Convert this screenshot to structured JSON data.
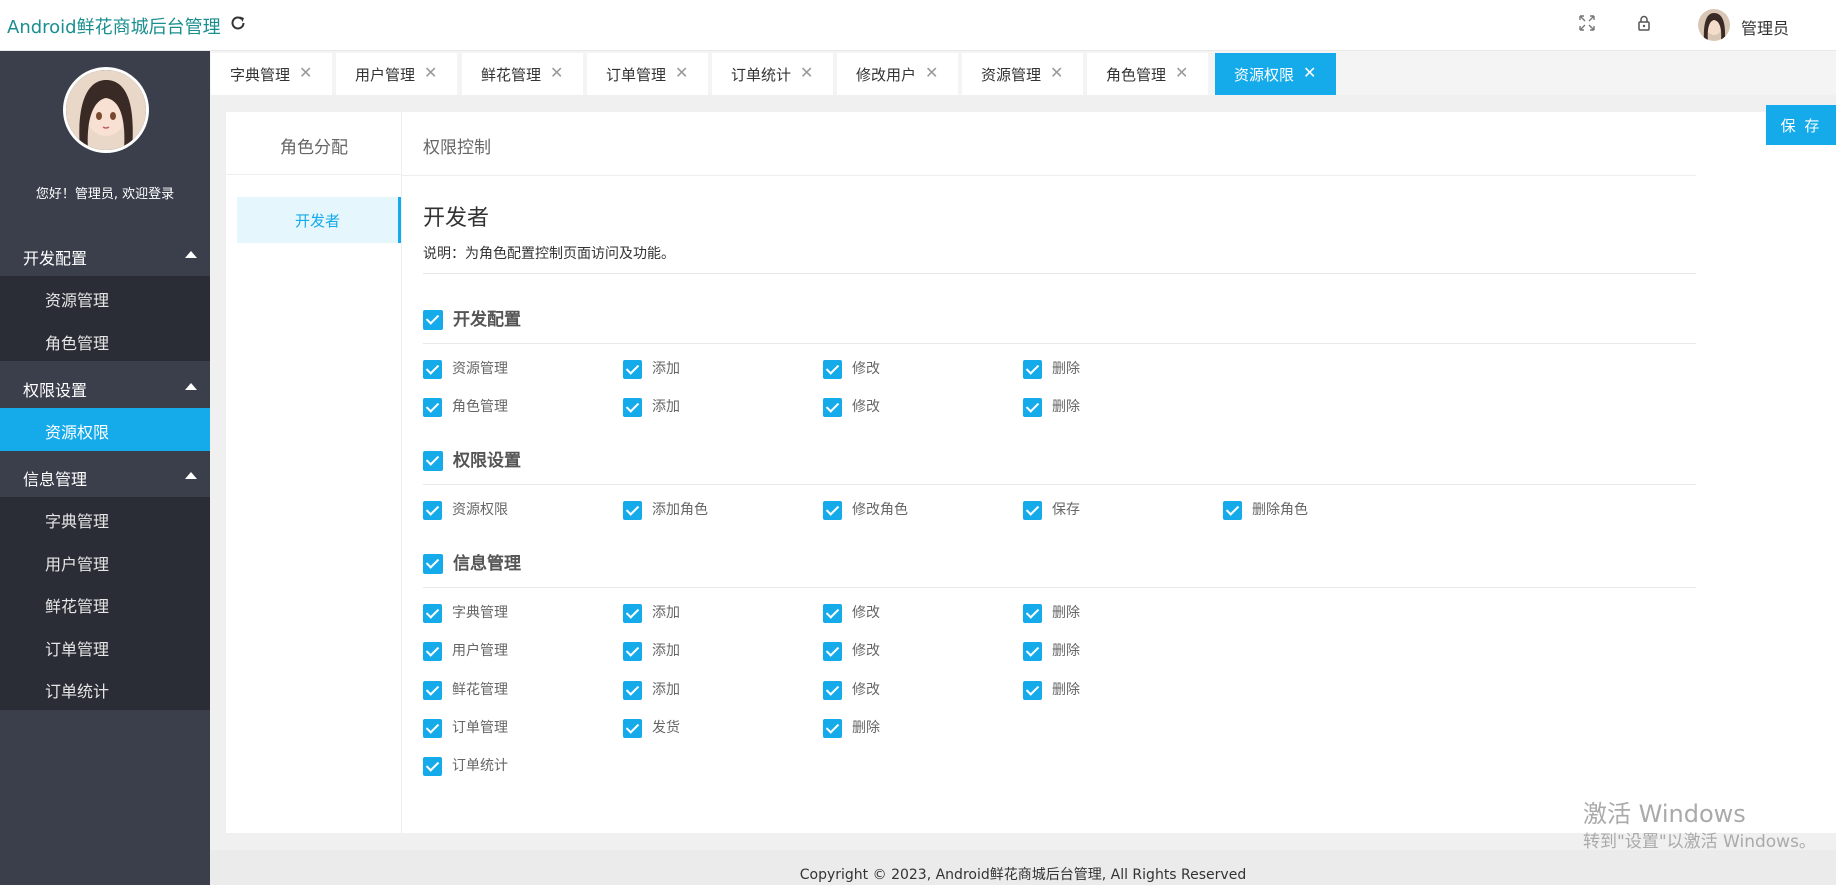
{
  "header": {
    "app_title": "Android鲜花商城后台管理",
    "user_name": "管理员"
  },
  "sidebar": {
    "welcome": "您好！管理员, 欢迎登录",
    "groups": [
      {
        "label": "开发配置",
        "items": [
          "资源管理",
          "角色管理"
        ]
      },
      {
        "label": "权限设置",
        "items": [
          "资源权限"
        ]
      },
      {
        "label": "信息管理",
        "items": [
          "字典管理",
          "用户管理",
          "鲜花管理",
          "订单管理",
          "订单统计"
        ]
      }
    ],
    "active_item": "资源权限"
  },
  "tabs": [
    "字典管理",
    "用户管理",
    "鲜花管理",
    "订单管理",
    "订单统计",
    "修改用户",
    "资源管理",
    "角色管理",
    "资源权限"
  ],
  "active_tab": "资源权限",
  "main": {
    "left_header": "角色分配",
    "right_header": "权限控制",
    "save_label": "保 存",
    "roles": [
      "开发者"
    ],
    "role_title": "开发者",
    "description": "说明：为角色配置控制页面访问及功能。",
    "groups": [
      {
        "label": "开发配置",
        "checked": true,
        "rows": [
          [
            "资源管理",
            "添加",
            "修改",
            "删除"
          ],
          [
            "角色管理",
            "添加",
            "修改",
            "删除"
          ]
        ]
      },
      {
        "label": "权限设置",
        "checked": true,
        "rows": [
          [
            "资源权限",
            "添加角色",
            "修改角色",
            "保存",
            "删除角色"
          ]
        ]
      },
      {
        "label": "信息管理",
        "checked": true,
        "rows": [
          [
            "字典管理",
            "添加",
            "修改",
            "删除"
          ],
          [
            "用户管理",
            "添加",
            "修改",
            "删除"
          ],
          [
            "鲜花管理",
            "添加",
            "修改",
            "删除"
          ],
          [
            "订单管理",
            "发货",
            "删除"
          ],
          [
            "订单统计"
          ]
        ]
      }
    ]
  },
  "watermark": {
    "line1": "激活 Windows",
    "line2": "转到\"设置\"以激活 Windows。"
  },
  "footer": "Copyright © 2023, Android鲜花商城后台管理, All Rights Reserved",
  "colors": {
    "accent": "#15aaea",
    "sidebar": "#3b3f4c",
    "sidebar_sub": "#2a2d36",
    "title": "#1a8f8f"
  }
}
